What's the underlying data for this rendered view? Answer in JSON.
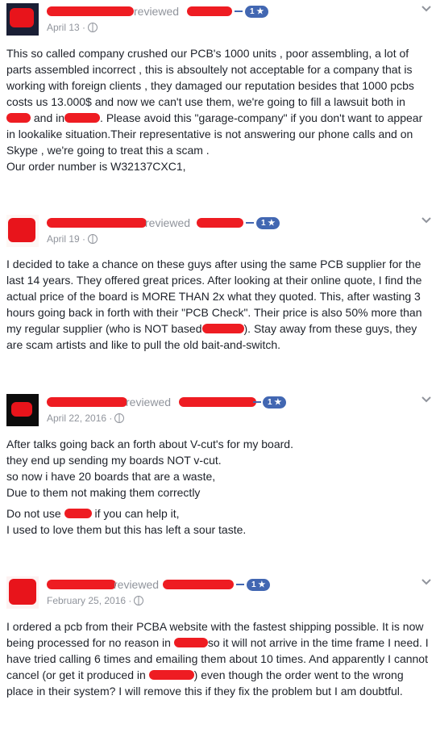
{
  "reviews": [
    {
      "reviewed_label": "reviewed",
      "badge": "1 ★",
      "date": "April 13",
      "paragraphs": [
        {
          "segments": [
            {
              "t": "This so called company crushed our PCB's 1000 units , poor assembling, a lot of parts assembled incorrect , this is absoultely not acceptable for a company that is working with foreign clients , they damaged our reputation besides that 1000 pcbs costs us 13.000$ and now we can't use them, we're going to fill a lawsuit both in "
            },
            {
              "r": 1
            },
            {
              "t": " and in"
            },
            {
              "r": 2
            },
            {
              "t": ". Please avoid this \"garage-company\" if you don't want to appear in lookalike situation.Their representative is not answering our phone calls and on Skype , we're going to treat this a scam ."
            }
          ]
        },
        {
          "segments": [
            {
              "t": "Our order number is W32137CXC1,"
            }
          ]
        }
      ]
    },
    {
      "reviewed_label": "reviewed",
      "badge": "1 ★",
      "date": "April 19",
      "paragraphs": [
        {
          "segments": [
            {
              "t": "I decided to take a chance on these guys after using the same PCB supplier for the last 14 years. They offered great prices. After looking at their online quote, I find the actual price of the board is MORE THAN 2x what they quoted. This, after wasting 3 hours going back in forth with their \"PCB Check\". Their price is also 50% more than my regular supplier (who is NOT based"
            },
            {
              "r": 3
            },
            {
              "t": "). Stay away from these guys, they are scam artists and like to pull the old bait-and-switch."
            }
          ]
        }
      ]
    },
    {
      "reviewed_label": "reviewed",
      "badge": "1 ★",
      "date": "April 22, 2016",
      "paragraphs": [
        {
          "segments": [
            {
              "t": "After talks going back an forth about V-cut's for my board."
            }
          ]
        },
        {
          "segments": [
            {
              "t": "they end up sending my boards NOT v-cut."
            }
          ]
        },
        {
          "segments": [
            {
              "t": "so now i have 20 boards that are a waste,"
            }
          ]
        },
        {
          "segments": [
            {
              "t": "Due to them not making them correctly"
            }
          ]
        },
        {
          "gap": true
        },
        {
          "segments": [
            {
              "t": "Do not use "
            },
            {
              "r": 4
            },
            {
              "t": " if you can help it,"
            }
          ]
        },
        {
          "segments": [
            {
              "t": "I used to love them but this has left a sour taste."
            }
          ]
        }
      ]
    },
    {
      "reviewed_label": "reviewed",
      "badge": "1 ★",
      "date": "February 25, 2016",
      "paragraphs": [
        {
          "segments": [
            {
              "t": "I ordered a pcb from their PCBA website with the fastest shipping possible. It is now being processed for no reason in "
            },
            {
              "r": 5
            },
            {
              "t": "so it will not arrive in the time frame I need. I have tried calling 6 times and emailing them about 10 times. And apparently I cannot cancel (or get it produced in "
            },
            {
              "r": 6
            },
            {
              "t": ") even though the order went to the wrong place in their system? I will remove this if they fix the problem but I am doubtful."
            }
          ]
        }
      ]
    }
  ],
  "colors": {
    "redaction": "#ee1c22",
    "accent": "#4267b2",
    "meta": "#90949c",
    "text": "#1d2129"
  },
  "icons": {
    "privacy": "globe-icon",
    "menu": "chevron-down-icon"
  }
}
